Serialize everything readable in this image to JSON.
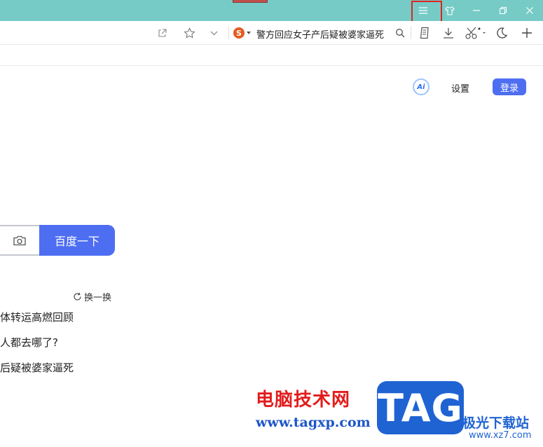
{
  "browser": {
    "hot_query": "警方回应女子产后疑被婆家逼死",
    "search_engine_icon": "S",
    "icons": [
      "menu-icon",
      "skin-icon",
      "minimize-icon",
      "restore-icon",
      "close-icon",
      "share-icon",
      "star-icon",
      "chevron-down-icon",
      "search-icon",
      "reader-icon",
      "download-icon",
      "scissors-icon",
      "moon-icon",
      "plus-icon"
    ]
  },
  "page": {
    "ai_label": "Ai",
    "settings_label": "设置",
    "login_label": "登录",
    "search_button": "百度一下",
    "refresh_label": "换一换",
    "hot_list": [
      "体转运高燃回顾",
      "人都去哪了?",
      "后疑被婆家逼死"
    ]
  },
  "watermark": {
    "site_name": "电脑技术网",
    "site_url": "www.tagxp.com",
    "logo_text": "TAG",
    "partner_name": "极光下载站",
    "partner_url": "www.xz7.com"
  },
  "colors": {
    "titlebar": "#76cbc6",
    "accent": "#4e6ef2",
    "highlight": "#e0241f"
  }
}
